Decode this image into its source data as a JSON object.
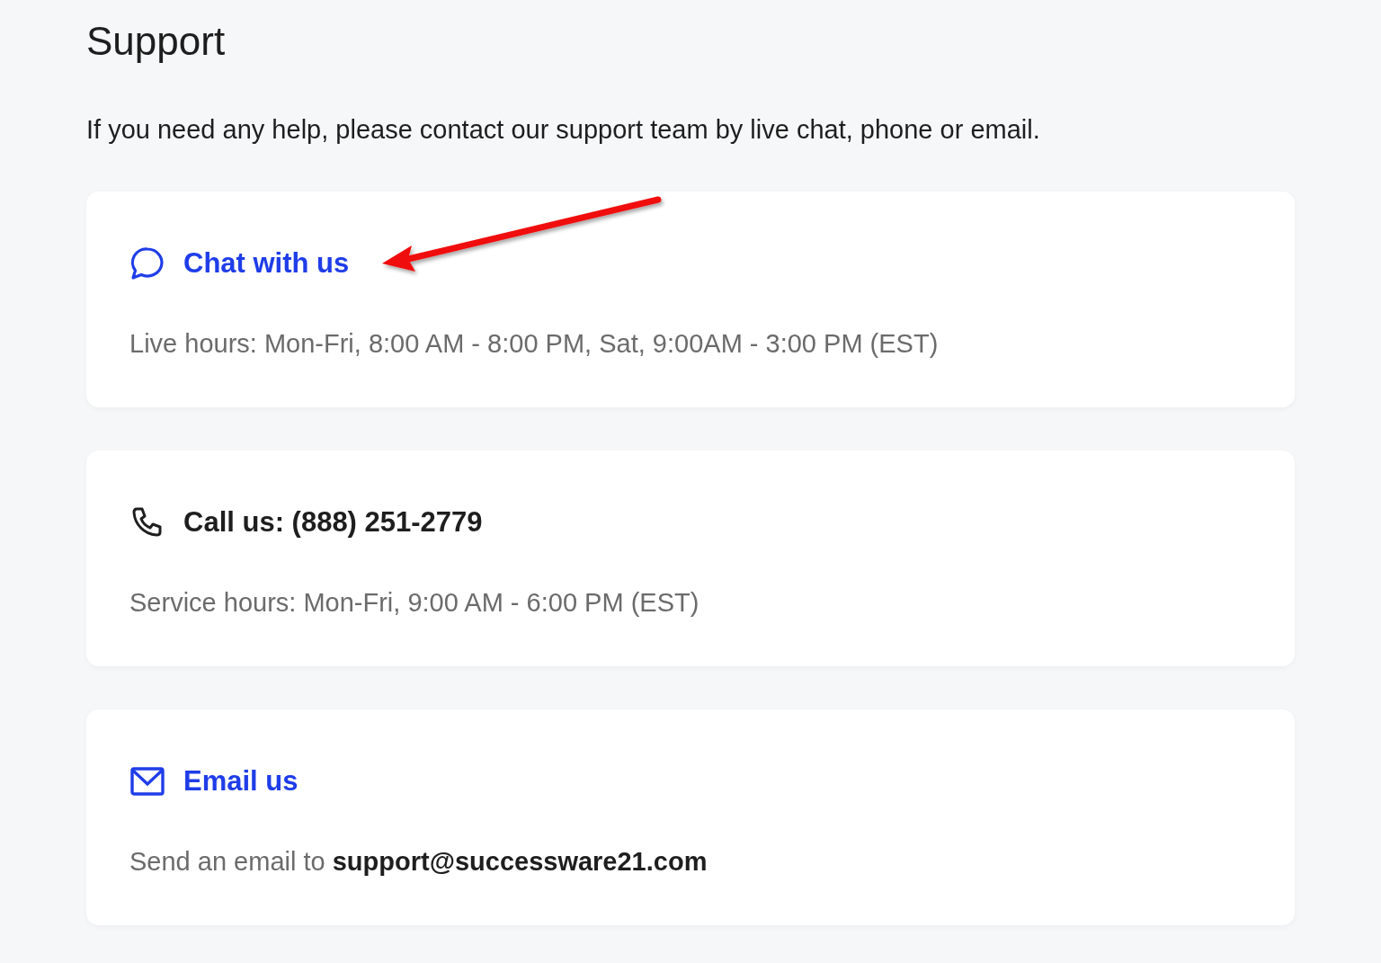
{
  "title": "Support",
  "intro": "If you need any help, please contact our support team by live chat, phone or email.",
  "cards": [
    {
      "kind": "chat",
      "heading": "Chat with us",
      "link": true,
      "text": "Live hours: Mon-Fri, 8:00 AM - 8:00 PM, Sat, 9:00AM - 3:00 PM (EST)"
    },
    {
      "kind": "phone",
      "heading": "Call us: (888) 251-2779",
      "link": false,
      "text": "Service hours: Mon-Fri, 9:00 AM - 6:00 PM (EST)"
    },
    {
      "kind": "email",
      "heading": "Email us",
      "link": true,
      "text": "Send an email to **support@successware21.com**"
    }
  ]
}
